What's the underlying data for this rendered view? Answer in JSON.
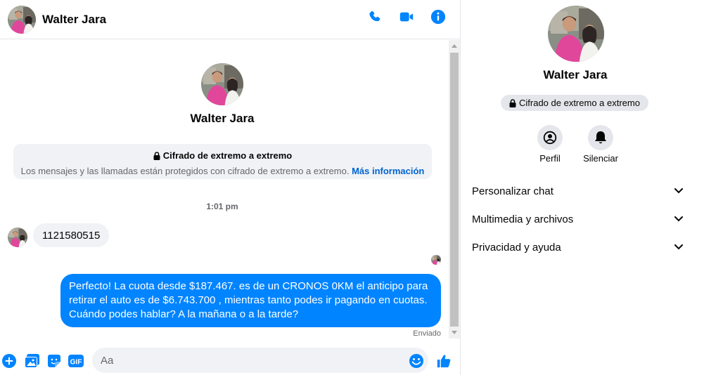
{
  "contact": {
    "name": "Walter Jara"
  },
  "header": {
    "actions": [
      "phone-icon",
      "video-icon",
      "info-icon"
    ]
  },
  "intro": {
    "name": "Walter Jara",
    "encryption_title": "Cifrado de extremo a extremo",
    "encryption_text": "Los mensajes y las llamadas están protegidos con cifrado de extremo a extremo.",
    "more_info": "Más información"
  },
  "messages": {
    "timestamp": "1:01 pm",
    "incoming": "1121580515",
    "outgoing": "Perfecto! La cuota desde $187.467. es de un CRONOS 0KM el anticipo para retirar el auto es de $6.743.700 , mientras tanto podes ir pagando en cuotas. Cuándo podes hablar? A la mañana o a la tarde?",
    "status": "Enviado"
  },
  "composer": {
    "placeholder": "Aa",
    "icons": [
      "plus-icon",
      "image-icon",
      "sticker-icon",
      "gif-icon",
      "emoji-icon",
      "like-icon"
    ]
  },
  "info": {
    "name": "Walter Jara",
    "badge": "Cifrado de extremo a extremo",
    "actions": [
      {
        "label": "Perfil"
      },
      {
        "label": "Silenciar"
      }
    ],
    "sections": [
      {
        "label": "Personalizar chat"
      },
      {
        "label": "Multimedia y archivos"
      },
      {
        "label": "Privacidad y ayuda"
      }
    ]
  },
  "colors": {
    "accent": "#0084ff",
    "link": "#0064d1",
    "bubble_in": "#f0f2f5"
  }
}
